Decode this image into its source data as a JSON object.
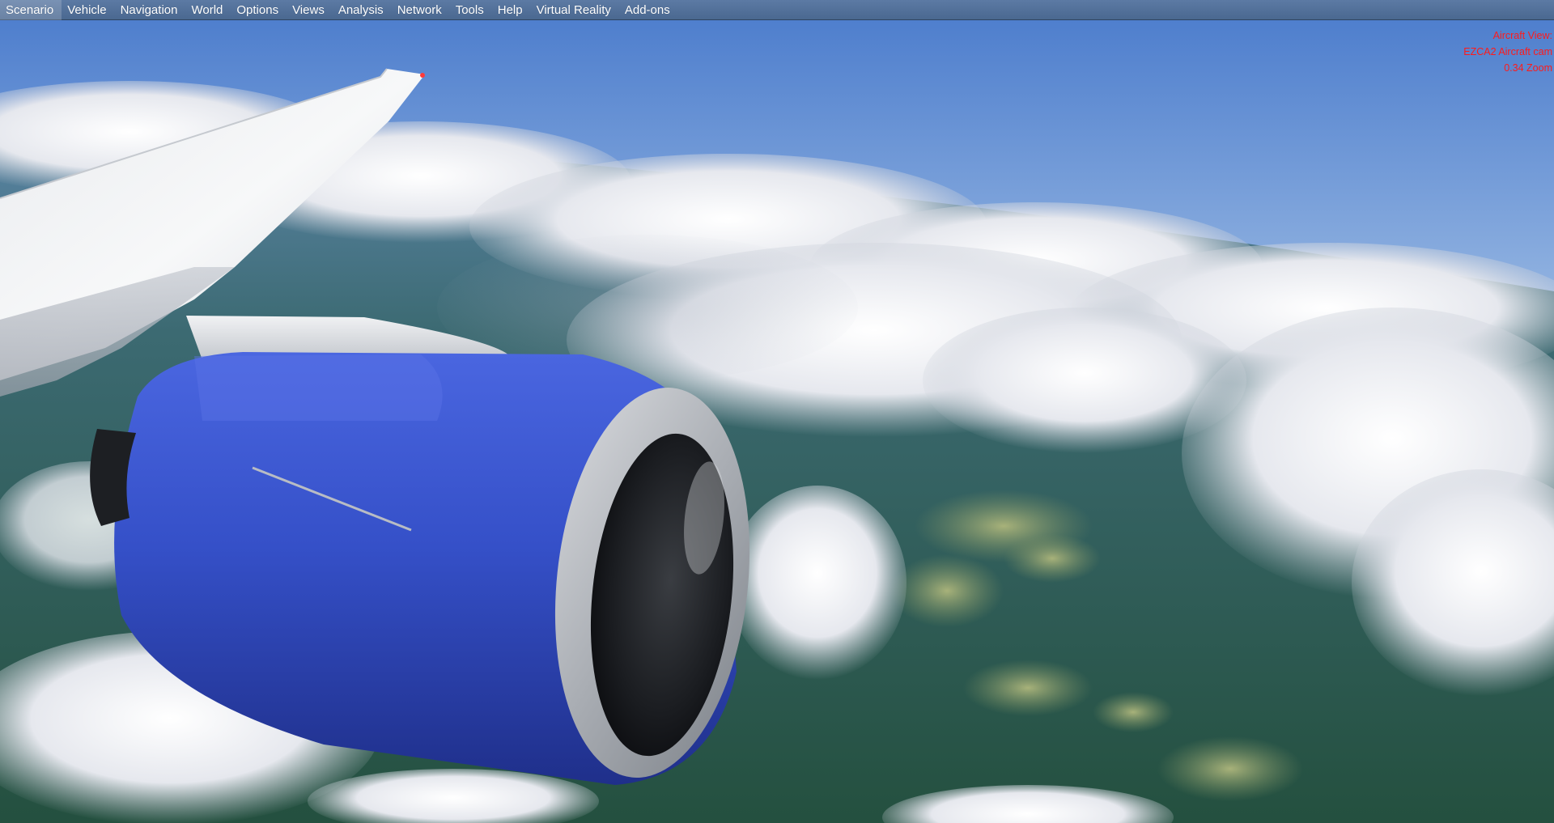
{
  "menubar": {
    "items": [
      {
        "label": "Scenario"
      },
      {
        "label": "Vehicle"
      },
      {
        "label": "Navigation"
      },
      {
        "label": "World"
      },
      {
        "label": "Options"
      },
      {
        "label": "Views"
      },
      {
        "label": "Analysis"
      },
      {
        "label": "Network"
      },
      {
        "label": "Tools"
      },
      {
        "label": "Help"
      },
      {
        "label": "Virtual Reality"
      },
      {
        "label": "Add-ons"
      }
    ]
  },
  "hud": {
    "line1": "Aircraft View:",
    "line2": "EZCA2 Aircraft cam",
    "line3": "0.34 Zoom",
    "color": "#ff1a1a"
  },
  "scene": {
    "sky_top": "#4f7fcc",
    "sky_horizon": "#f6f1f2",
    "nacelle_color": "#3550c8",
    "ground_color": "#2f5a4e"
  }
}
